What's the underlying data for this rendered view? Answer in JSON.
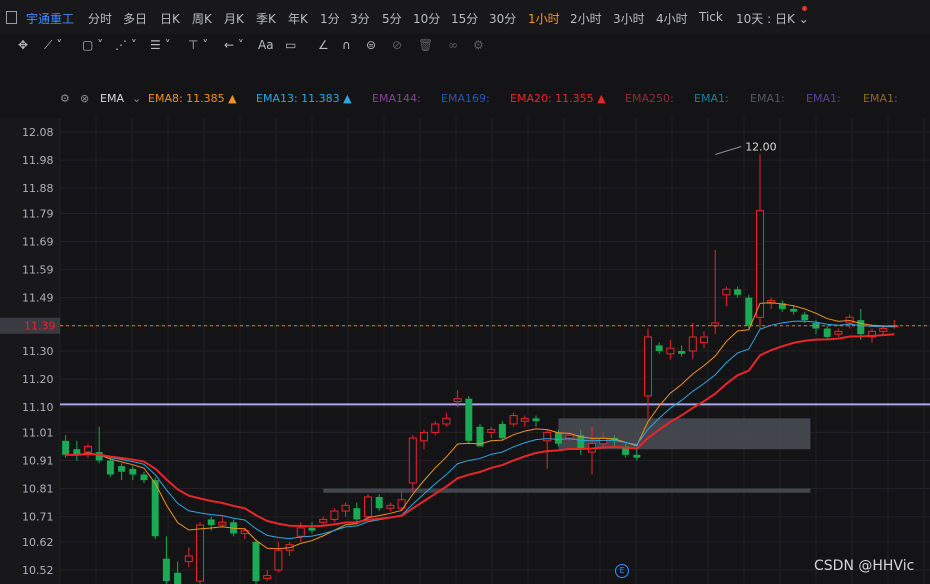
{
  "symbol": "宇通重工",
  "timeframes": [
    {
      "label": "分时",
      "active": false
    },
    {
      "label": "多日",
      "active": false
    },
    {
      "label": "日K",
      "active": false
    },
    {
      "label": "周K",
      "active": false
    },
    {
      "label": "月K",
      "active": false
    },
    {
      "label": "季K",
      "active": false
    },
    {
      "label": "年K",
      "active": false
    },
    {
      "label": "1分",
      "active": false
    },
    {
      "label": "3分",
      "active": false
    },
    {
      "label": "5分",
      "active": false
    },
    {
      "label": "10分",
      "active": false
    },
    {
      "label": "15分",
      "active": false
    },
    {
      "label": "30分",
      "active": false
    },
    {
      "label": "1小时",
      "active": true
    },
    {
      "label": "2小时",
      "active": false
    },
    {
      "label": "3小时",
      "active": false
    },
    {
      "label": "4小时",
      "active": false
    },
    {
      "label": "Tick",
      "active": false
    }
  ],
  "range_selector": "10天 : 日K",
  "toolbar_icons": [
    "crosshair-icon",
    "trend-line-icon",
    "rectangle-icon",
    "pattern-icon",
    "fib-icon",
    "arrow-icon",
    "text-icon",
    "comment-icon",
    "angle-icon",
    "magnet-icon",
    "lock-icon",
    "hide-icon",
    "trash-icon",
    "link-icon",
    "settings-icon"
  ],
  "indicator": {
    "name": "EMA",
    "items": [
      {
        "label": "EMA8:",
        "value": "11.385",
        "color": "#f39221",
        "arrow": true
      },
      {
        "label": "EMA13:",
        "value": "11.383",
        "color": "#2ea6e0",
        "arrow": true
      },
      {
        "label": "EMA144:",
        "value": "",
        "color": "#8a3f9c",
        "arrow": false
      },
      {
        "label": "EMA169:",
        "value": "",
        "color": "#2557b8",
        "arrow": false
      },
      {
        "label": "EMA20:",
        "value": "11.355",
        "color": "#e8262a",
        "arrow": true
      },
      {
        "label": "EMA250:",
        "value": "",
        "color": "#8f2d36",
        "arrow": false
      },
      {
        "label": "EMA1:",
        "value": "",
        "color": "#1e7da0",
        "arrow": false
      },
      {
        "label": "EMA1:",
        "value": "",
        "color": "#55575c",
        "arrow": false
      },
      {
        "label": "EMA1:",
        "value": "",
        "color": "#5a3fa6",
        "arrow": false
      },
      {
        "label": "EMA1:",
        "value": "",
        "color": "#8c6a1e",
        "arrow": false
      }
    ]
  },
  "watermark": "CSDN @HHVic",
  "chart_data": {
    "type": "candlestick",
    "y_ticks": [
      "12.08",
      "11.98",
      "11.88",
      "11.79",
      "11.69",
      "11.59",
      "11.49",
      "11.39",
      "11.30",
      "11.20",
      "11.10",
      "11.01",
      "10.91",
      "10.81",
      "10.71",
      "10.62",
      "10.52"
    ],
    "ylim": [
      10.47,
      12.13
    ],
    "current_price": 11.39,
    "current_price_label": "11.39",
    "max_annotation": {
      "price": 12.0,
      "label": "12.00",
      "bar_index": 58
    },
    "horizontal_line": 11.11,
    "zones": [
      {
        "from_bar": 44.5,
        "to_bar": 67,
        "low": 10.95,
        "high": 11.06
      },
      {
        "from_bar": 23.5,
        "to_bar": 67,
        "low": 10.795,
        "high": 10.81
      }
    ],
    "candles": [
      [
        10.98,
        10.93,
        11.0,
        10.92
      ],
      [
        10.95,
        10.93,
        10.98,
        10.91
      ],
      [
        10.94,
        10.96,
        10.97,
        10.92
      ],
      [
        10.94,
        10.91,
        11.03,
        10.9
      ],
      [
        10.91,
        10.86,
        10.92,
        10.85
      ],
      [
        10.89,
        10.87,
        10.9,
        10.84
      ],
      [
        10.88,
        10.86,
        10.89,
        10.84
      ],
      [
        10.86,
        10.84,
        10.87,
        10.83
      ],
      [
        10.84,
        10.64,
        10.85,
        10.63
      ],
      [
        10.56,
        10.48,
        10.64,
        10.47
      ],
      [
        10.51,
        10.47,
        10.55,
        10.46
      ],
      [
        10.55,
        10.57,
        10.6,
        10.53
      ],
      [
        10.48,
        10.68,
        10.69,
        10.46
      ],
      [
        10.7,
        10.68,
        10.71,
        10.66
      ],
      [
        10.68,
        10.69,
        10.71,
        10.67
      ],
      [
        10.69,
        10.65,
        10.7,
        10.64
      ],
      [
        10.65,
        10.66,
        10.67,
        10.63
      ],
      [
        10.62,
        10.48,
        10.63,
        10.47
      ],
      [
        10.49,
        10.5,
        10.52,
        10.48
      ],
      [
        10.52,
        10.59,
        10.62,
        10.51
      ],
      [
        10.59,
        10.61,
        10.62,
        10.57
      ],
      [
        10.64,
        10.67,
        10.69,
        10.62
      ],
      [
        10.67,
        10.66,
        10.69,
        10.65
      ],
      [
        10.69,
        10.7,
        10.71,
        10.68
      ],
      [
        10.7,
        10.73,
        10.74,
        10.69
      ],
      [
        10.73,
        10.75,
        10.76,
        10.71
      ],
      [
        10.74,
        10.7,
        10.76,
        10.69
      ],
      [
        10.71,
        10.78,
        10.79,
        10.7
      ],
      [
        10.78,
        10.74,
        10.79,
        10.73
      ],
      [
        10.74,
        10.75,
        10.76,
        10.73
      ],
      [
        10.74,
        10.77,
        10.8,
        10.73
      ],
      [
        10.83,
        10.99,
        11.0,
        10.8
      ],
      [
        10.98,
        11.01,
        11.02,
        10.95
      ],
      [
        11.01,
        11.04,
        11.05,
        11.0
      ],
      [
        11.04,
        11.06,
        11.08,
        11.03
      ],
      [
        11.12,
        11.13,
        11.16,
        11.1
      ],
      [
        11.13,
        10.98,
        11.14,
        10.97
      ],
      [
        11.03,
        10.96,
        11.04,
        10.96
      ],
      [
        11.01,
        11.02,
        11.03,
        10.99
      ],
      [
        11.04,
        10.99,
        11.05,
        10.98
      ],
      [
        11.04,
        11.07,
        11.08,
        11.03
      ],
      [
        11.05,
        11.06,
        11.07,
        11.03
      ],
      [
        11.06,
        11.05,
        11.07,
        11.03
      ],
      [
        10.98,
        11.01,
        11.02,
        10.88
      ],
      [
        11.01,
        10.97,
        11.02,
        10.96
      ],
      [
        10.99,
        11.0,
        11.01,
        10.98
      ],
      [
        11.0,
        10.95,
        11.02,
        10.93
      ],
      [
        10.94,
        10.97,
        11.03,
        10.86
      ],
      [
        10.97,
        10.99,
        11.01,
        10.96
      ],
      [
        10.99,
        10.98,
        11.0,
        10.96
      ],
      [
        10.96,
        10.93,
        10.97,
        10.92
      ],
      [
        10.93,
        10.92,
        10.95,
        10.91
      ],
      [
        11.14,
        11.35,
        11.38,
        11.06
      ],
      [
        11.32,
        11.3,
        11.33,
        11.29
      ],
      [
        11.29,
        11.31,
        11.34,
        11.27
      ],
      [
        11.3,
        11.29,
        11.32,
        11.28
      ],
      [
        11.3,
        11.35,
        11.4,
        11.27
      ],
      [
        11.33,
        11.35,
        11.37,
        11.31
      ],
      [
        11.39,
        11.4,
        11.66,
        11.36
      ],
      [
        11.5,
        11.52,
        11.53,
        11.46
      ],
      [
        11.52,
        11.5,
        11.53,
        11.49
      ],
      [
        11.49,
        11.39,
        11.5,
        11.38
      ],
      [
        11.42,
        11.8,
        12.0,
        11.38
      ],
      [
        11.47,
        11.48,
        11.49,
        11.45
      ],
      [
        11.47,
        11.45,
        11.48,
        11.44
      ],
      [
        11.45,
        11.44,
        11.46,
        11.43
      ],
      [
        11.43,
        11.41,
        11.44,
        11.4
      ],
      [
        11.4,
        11.38,
        11.41,
        11.36
      ],
      [
        11.38,
        11.35,
        11.39,
        11.34
      ],
      [
        11.36,
        11.37,
        11.38,
        11.35
      ],
      [
        11.4,
        11.42,
        11.43,
        11.38
      ],
      [
        11.41,
        11.36,
        11.45,
        11.34
      ],
      [
        11.35,
        11.37,
        11.38,
        11.33
      ],
      [
        11.37,
        11.38,
        11.39,
        11.36
      ],
      [
        11.39,
        11.39,
        11.41,
        11.38
      ]
    ]
  }
}
